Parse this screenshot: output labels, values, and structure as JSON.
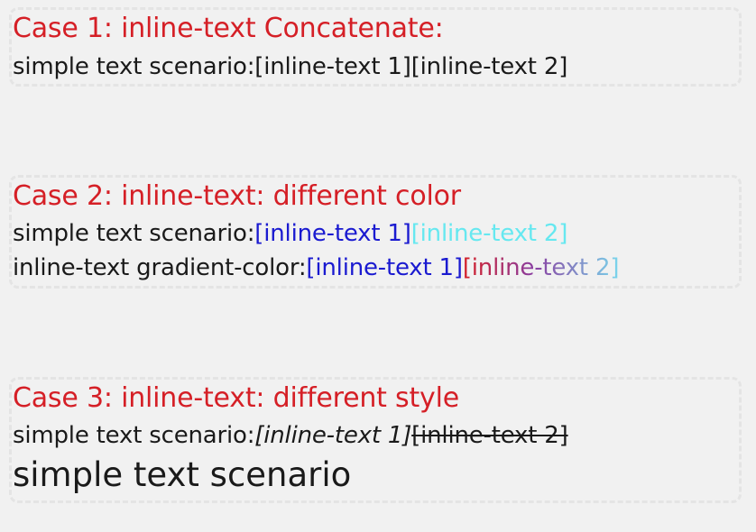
{
  "case1": {
    "title": "Case 1:  inline-text Concatenate:",
    "line1": {
      "prefix": "simple text scenario:",
      "span1": "[inline-text 1]",
      "span2": "[inline-text 2]"
    }
  },
  "case2": {
    "title": "Case 2:  inline-text: different color",
    "line1": {
      "prefix": "simple text scenario:",
      "span1": "[inline-text 1]",
      "span2": "[inline-text 2]"
    },
    "line2": {
      "prefix": "inline-text gradient-color:",
      "span1": "[inline-text 1]",
      "span2": "[inline-text 2]"
    },
    "colors": {
      "span1": "#1a1ad0",
      "span2": "#66e8f0",
      "gradient_start": "#d51f26",
      "gradient_end": "#7ad6ec"
    }
  },
  "case3": {
    "title": "Case 3:  inline-text: different style",
    "line1": {
      "prefix": "simple text scenario:",
      "span1": "[inline-text 1]",
      "span2": "[inline-text 2]"
    },
    "line2": "simple text scenario"
  },
  "colors": {
    "heading": "#d51f26",
    "text": "#1a1a1a",
    "background": "#f1f1f1",
    "dashed_border": "#e4e4e4"
  }
}
